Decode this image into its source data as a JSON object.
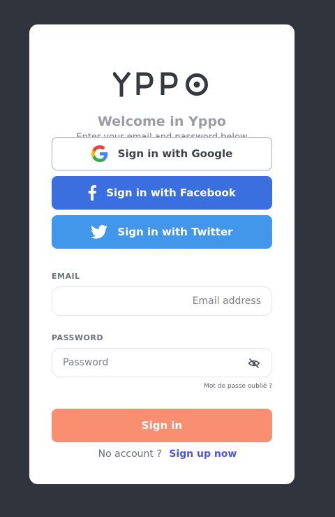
{
  "brand": {
    "logo_text": "YPPO"
  },
  "header": {
    "title": "Welcome in Yppo",
    "subtitle": "Enter your email and password below"
  },
  "social": {
    "google_label": "Sign in with Google",
    "facebook_label": "Sign in with Facebook",
    "twitter_label": "Sign in with Twitter"
  },
  "form": {
    "email_label": "EMAIL",
    "email_placeholder": "Email address",
    "email_value": "",
    "password_label": "PASSWORD",
    "password_placeholder": "Password",
    "password_value": "",
    "forgot_label": "Mot de passe oublié ?",
    "signin_label": "Sign in"
  },
  "footer": {
    "no_account_text": "No account ?",
    "signup_label": "Sign up now"
  },
  "colors": {
    "page_background": "#30353d",
    "card": "#ffffff",
    "facebook": "#3b6fe0",
    "twitter": "#4297ea",
    "signin": "#f78f70",
    "link": "#4a56e2"
  },
  "icons": {
    "google": "google-icon",
    "facebook": "facebook-icon",
    "twitter": "twitter-icon",
    "password_toggle": "eye-off-icon"
  }
}
